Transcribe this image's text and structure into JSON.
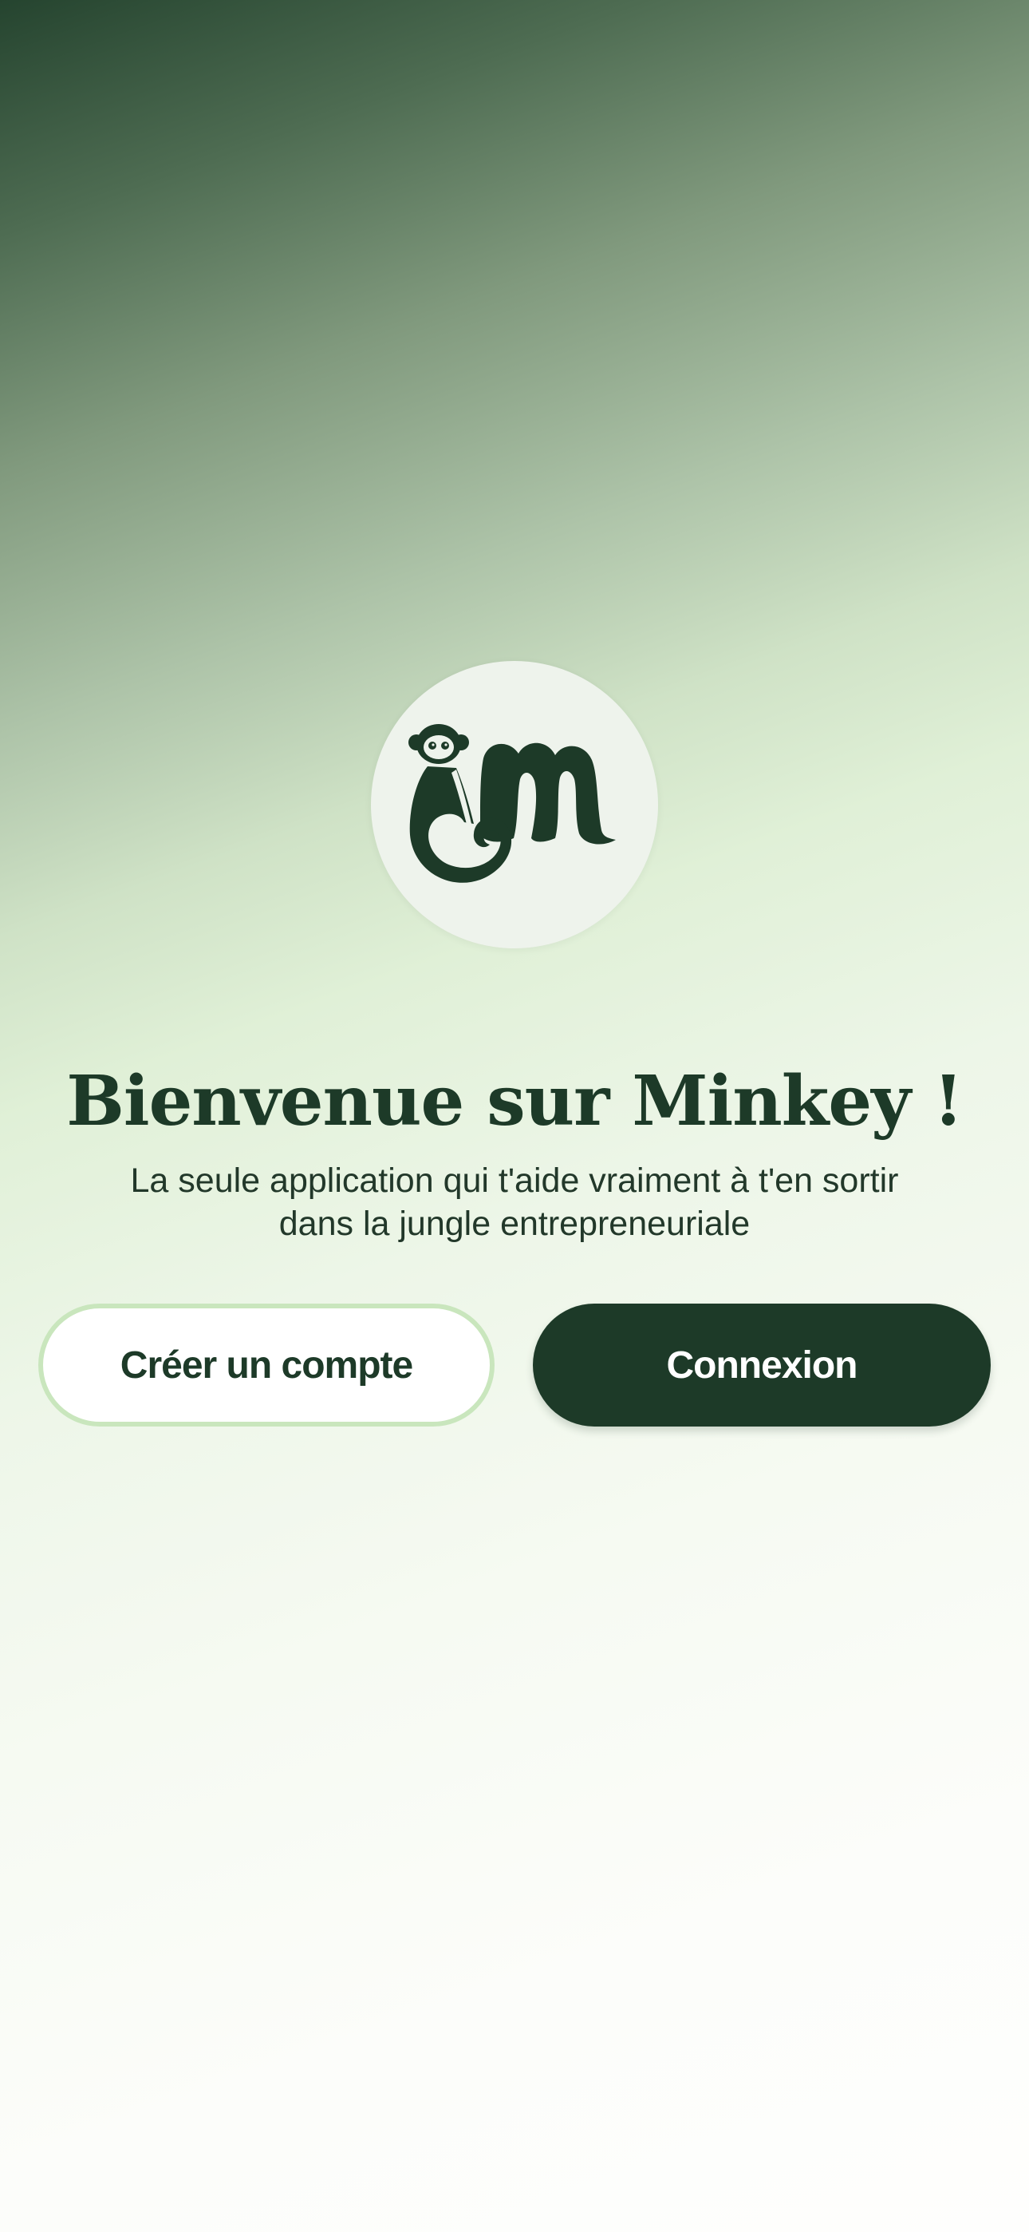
{
  "welcome": {
    "logo_icon": "minkey-monkey-logo-icon",
    "title": "Bienvenue sur Minkey !",
    "subtitle_line1": "La seule application qui t'aide vraiment à t'en sortir",
    "subtitle_line2": "dans la jungle entrepreneuriale"
  },
  "actions": {
    "create_account_label": "Créer un compte",
    "login_label": "Connexion"
  },
  "colors": {
    "brand_dark_green": "#1d3a28",
    "light_green_border": "#c9e6bd",
    "logo_circle_bg": "#eef3ec"
  }
}
